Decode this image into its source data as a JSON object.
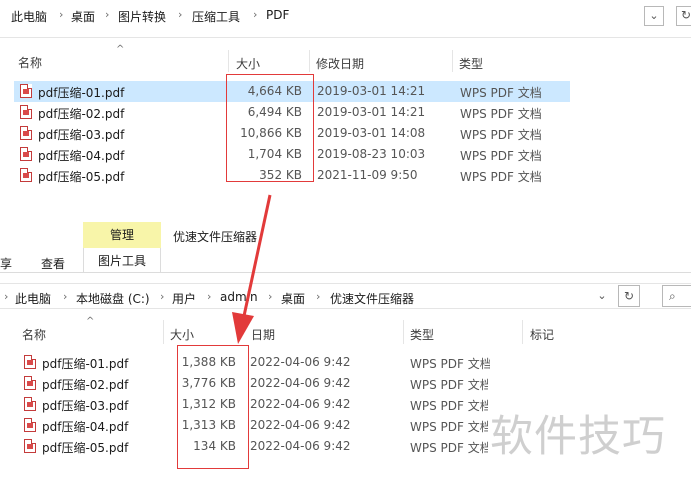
{
  "top": {
    "breadcrumb": [
      "此电脑",
      "桌面",
      "图片转换",
      "压缩工具",
      "PDF"
    ],
    "columns": {
      "name": "名称",
      "size": "大小",
      "modified": "修改日期",
      "type": "类型"
    },
    "files": [
      {
        "name": "pdf压缩-01.pdf",
        "size": "4,664 KB",
        "modified": "2019-03-01 14:21",
        "type": "WPS PDF 文档"
      },
      {
        "name": "pdf压缩-02.pdf",
        "size": "6,494 KB",
        "modified": "2019-03-01 14:21",
        "type": "WPS PDF 文档"
      },
      {
        "name": "pdf压缩-03.pdf",
        "size": "10,866 KB",
        "modified": "2019-03-01 14:08",
        "type": "WPS PDF 文档"
      },
      {
        "name": "pdf压缩-04.pdf",
        "size": "1,704 KB",
        "modified": "2019-08-23 10:03",
        "type": "WPS PDF 文档"
      },
      {
        "name": "pdf压缩-05.pdf",
        "size": "352 KB",
        "modified": "2021-11-09 9:50",
        "type": "WPS PDF 文档"
      }
    ]
  },
  "bottom": {
    "ribbon": {
      "share": "享",
      "view": "查看",
      "manage": "管理",
      "picture_tools": "图片工具",
      "title": "优速文件压缩器"
    },
    "breadcrumb": [
      "此电脑",
      "本地磁盘 (C:)",
      "用户",
      "admin",
      "桌面",
      "优速文件压缩器"
    ],
    "columns": {
      "name": "名称",
      "size": "大小",
      "modified": "日期",
      "type": "类型",
      "tags": "标记"
    },
    "files": [
      {
        "name": "pdf压缩-01.pdf",
        "size": "1,388 KB",
        "modified": "2022-04-06 9:42",
        "type": "WPS PDF 文档"
      },
      {
        "name": "pdf压缩-02.pdf",
        "size": "3,776 KB",
        "modified": "2022-04-06 9:42",
        "type": "WPS PDF 文档"
      },
      {
        "name": "pdf压缩-03.pdf",
        "size": "1,312 KB",
        "modified": "2022-04-06 9:42",
        "type": "WPS PDF 文档"
      },
      {
        "name": "pdf压缩-04.pdf",
        "size": "1,313 KB",
        "modified": "2022-04-06 9:42",
        "type": "WPS PDF 文档"
      },
      {
        "name": "pdf压缩-05.pdf",
        "size": "134 KB",
        "modified": "2022-04-06 9:42",
        "type": "WPS PDF 文档"
      }
    ]
  },
  "watermark": "软件技巧",
  "colors": {
    "highlight_box": "#e23a3a",
    "selection": "#cce8ff",
    "manage_tab": "#f8f5a9"
  },
  "icons": {
    "file": "pdf-file-icon",
    "dropdown": "chevron-down-icon",
    "refresh": "refresh-icon",
    "search": "search-icon",
    "arrow": "red-arrow-annotation"
  }
}
